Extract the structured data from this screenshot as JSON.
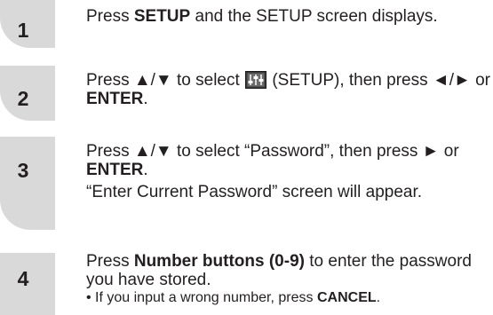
{
  "steps": [
    {
      "number": "1",
      "parts": {
        "a": "Press ",
        "b": "SETUP",
        "c": " and the SETUP screen displays."
      }
    },
    {
      "number": "2",
      "parts": {
        "a": "Press ▲/▼ to select ",
        "icon": "setup-icon",
        "b": " (SETUP), then press ◄/► or ",
        "c": "ENTER",
        "d": "."
      }
    },
    {
      "number": "3",
      "parts": {
        "a": "Press ▲/▼ to select “Password”, then press ► or ",
        "b": "ENTER",
        "c": "."
      },
      "note": "“Enter Current Password” screen will appear."
    },
    {
      "number": "4",
      "parts": {
        "a": "Press ",
        "b": "Number buttons (0-9)",
        "c": " to enter the password you have stored."
      },
      "bullet": {
        "a": "• If you input a wrong number, press ",
        "b": "CANCEL",
        "c": "."
      }
    }
  ]
}
